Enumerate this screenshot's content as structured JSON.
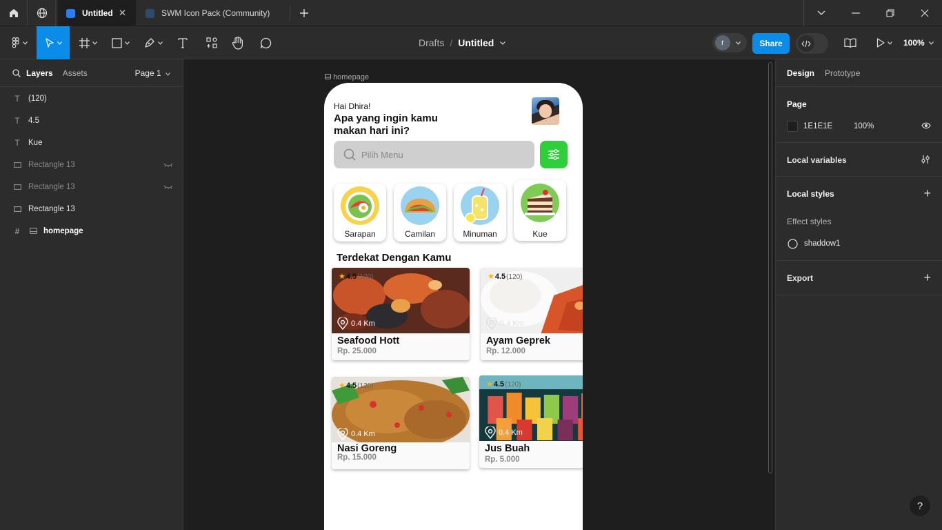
{
  "tabs": [
    {
      "label": "Untitled",
      "active": true
    },
    {
      "label": "SWM Icon Pack (Community)",
      "active": false
    }
  ],
  "breadcrumb": {
    "section": "Drafts",
    "separator": "/",
    "file": "Untitled"
  },
  "toolbar": {
    "share_label": "Share",
    "zoom": "100%",
    "avatar_initial": "r"
  },
  "left_panel": {
    "tab_layers": "Layers",
    "tab_assets": "Assets",
    "page_select": "Page 1",
    "layers": [
      {
        "type": "text",
        "name": "(120)",
        "hidden": false
      },
      {
        "type": "text",
        "name": "4.5",
        "hidden": false
      },
      {
        "type": "text",
        "name": "Kue",
        "hidden": false
      },
      {
        "type": "rect",
        "name": "Rectangle 13",
        "hidden": true
      },
      {
        "type": "rect",
        "name": "Rectangle 13",
        "hidden": true
      },
      {
        "type": "rect",
        "name": "Rectangle 13",
        "hidden": false
      },
      {
        "type": "frame",
        "name": "homepage",
        "hidden": false
      }
    ]
  },
  "canvas": {
    "frame_label": "homepage",
    "app": {
      "greeting": "Hai Dhira!",
      "question": "Apa yang ingin kamu makan hari ini?",
      "search_placeholder": "Pilih Menu",
      "categories": [
        {
          "label": "Sarapan"
        },
        {
          "label": "Camilan"
        },
        {
          "label": "Minuman"
        },
        {
          "label": "Kue"
        }
      ],
      "section_title": "Terdekat Dengan Kamu",
      "cards": [
        {
          "name": "Seafood Hott",
          "price": "Rp. 25.000",
          "rating": "4.5",
          "count": "(120)",
          "distance": "0.4 Km"
        },
        {
          "name": "Ayam Geprek",
          "price": "Rp. 12.000",
          "rating": "4.5",
          "count": "(120)",
          "distance": "0.4 Km"
        },
        {
          "name": "Nasi Goreng",
          "price": "Rp. 15.000",
          "rating": "4.5",
          "count": "(120)",
          "distance": "0.4 Km"
        },
        {
          "name": "Jus Buah",
          "price": "Rp. 5.000",
          "rating": "4.5",
          "count": "(120)",
          "distance": "0.4 Km"
        }
      ]
    }
  },
  "right_panel": {
    "tab_design": "Design",
    "tab_prototype": "Prototype",
    "page_title": "Page",
    "page_color": "1E1E1E",
    "page_opacity": "100%",
    "local_variables": "Local variables",
    "local_styles": "Local styles",
    "effect_styles": "Effect styles",
    "effect_name": "shaddow1",
    "export": "Export",
    "help": "?"
  },
  "colors": {
    "accent": "#0c8ce9",
    "filter_green": "#2fcf3b",
    "canvas_bg": "#1e1e1e"
  }
}
